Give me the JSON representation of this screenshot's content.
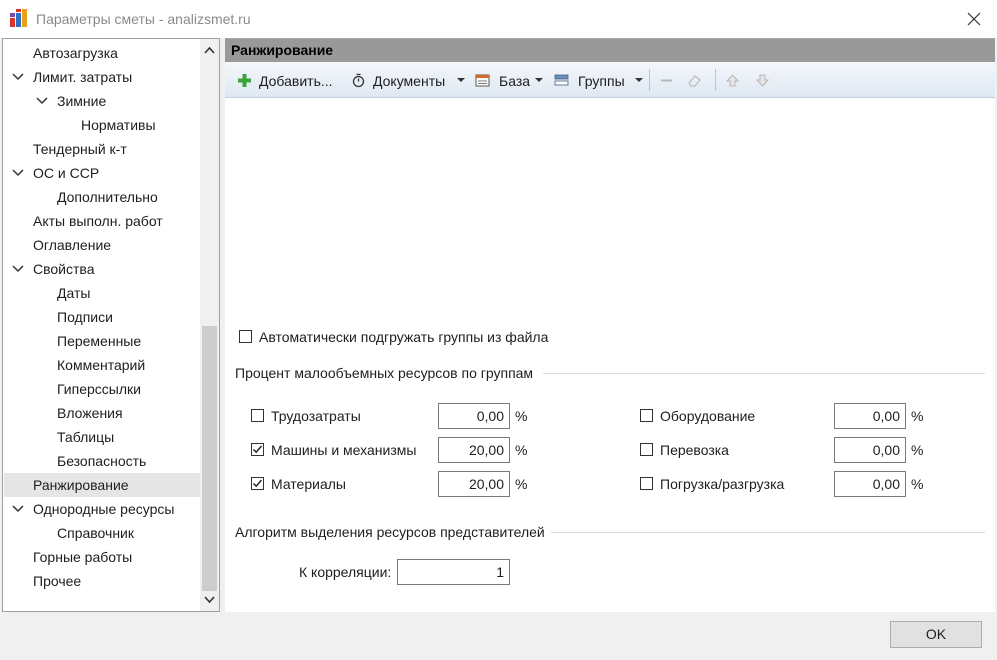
{
  "window": {
    "title": "Параметры сметы - analizsmet.ru",
    "app_icon": "app-grid-icon",
    "close_icon": "close-icon"
  },
  "tree": {
    "items": [
      {
        "label": "Автозагрузка",
        "level": 0,
        "expandable": false
      },
      {
        "label": "Лимит. затраты",
        "level": 0,
        "expandable": true
      },
      {
        "label": "Зимние",
        "level": 1,
        "expandable": true
      },
      {
        "label": "Нормативы",
        "level": 2,
        "expandable": false
      },
      {
        "label": "Тендерный к-т",
        "level": 0,
        "expandable": false
      },
      {
        "label": "ОС и ССР",
        "level": 0,
        "expandable": true
      },
      {
        "label": "Дополнительно",
        "level": 1,
        "expandable": false
      },
      {
        "label": "Акты выполн. работ",
        "level": 0,
        "expandable": false
      },
      {
        "label": "Оглавление",
        "level": 0,
        "expandable": false
      },
      {
        "label": "Свойства",
        "level": 0,
        "expandable": true
      },
      {
        "label": "Даты",
        "level": 1,
        "expandable": false
      },
      {
        "label": "Подписи",
        "level": 1,
        "expandable": false
      },
      {
        "label": "Переменные",
        "level": 1,
        "expandable": false
      },
      {
        "label": "Комментарий",
        "level": 1,
        "expandable": false
      },
      {
        "label": "Гиперссылки",
        "level": 1,
        "expandable": false
      },
      {
        "label": "Вложения",
        "level": 1,
        "expandable": false
      },
      {
        "label": "Таблицы",
        "level": 1,
        "expandable": false
      },
      {
        "label": "Безопасность",
        "level": 1,
        "expandable": false
      },
      {
        "label": "Ранжирование",
        "level": 0,
        "expandable": false,
        "selected": true
      },
      {
        "label": "Однородные ресурсы",
        "level": 0,
        "expandable": true
      },
      {
        "label": "Справочник",
        "level": 1,
        "expandable": false
      },
      {
        "label": "Горные работы",
        "level": 0,
        "expandable": false
      },
      {
        "label": "Прочее",
        "level": 0,
        "expandable": false
      }
    ]
  },
  "panel": {
    "title": "Ранжирование"
  },
  "toolbar": {
    "add_label": "Добавить...",
    "documents_label": "Документы",
    "base_label": "База",
    "groups_label": "Группы"
  },
  "form": {
    "auto_load_label": "Автоматически подгружать группы из файла",
    "auto_load_checked": false,
    "percent_section_title": "Процент малообъемных ресурсов по группам",
    "percent_unit": "%",
    "groups_left": [
      {
        "label": "Трудозатраты",
        "checked": false,
        "value": "0,00"
      },
      {
        "label": "Машины и механизмы",
        "checked": true,
        "value": "20,00"
      },
      {
        "label": "Материалы",
        "checked": true,
        "value": "20,00"
      }
    ],
    "groups_right": [
      {
        "label": "Оборудование",
        "checked": false,
        "value": "0,00"
      },
      {
        "label": "Перевозка",
        "checked": false,
        "value": "0,00"
      },
      {
        "label": "Погрузка/разгрузка",
        "checked": false,
        "value": "0,00"
      }
    ],
    "algo_section_title": "Алгоритм выделения ресурсов представителей",
    "correlation_label": "К корреляции:",
    "correlation_value": "1"
  },
  "footer": {
    "ok_label": "OK"
  }
}
